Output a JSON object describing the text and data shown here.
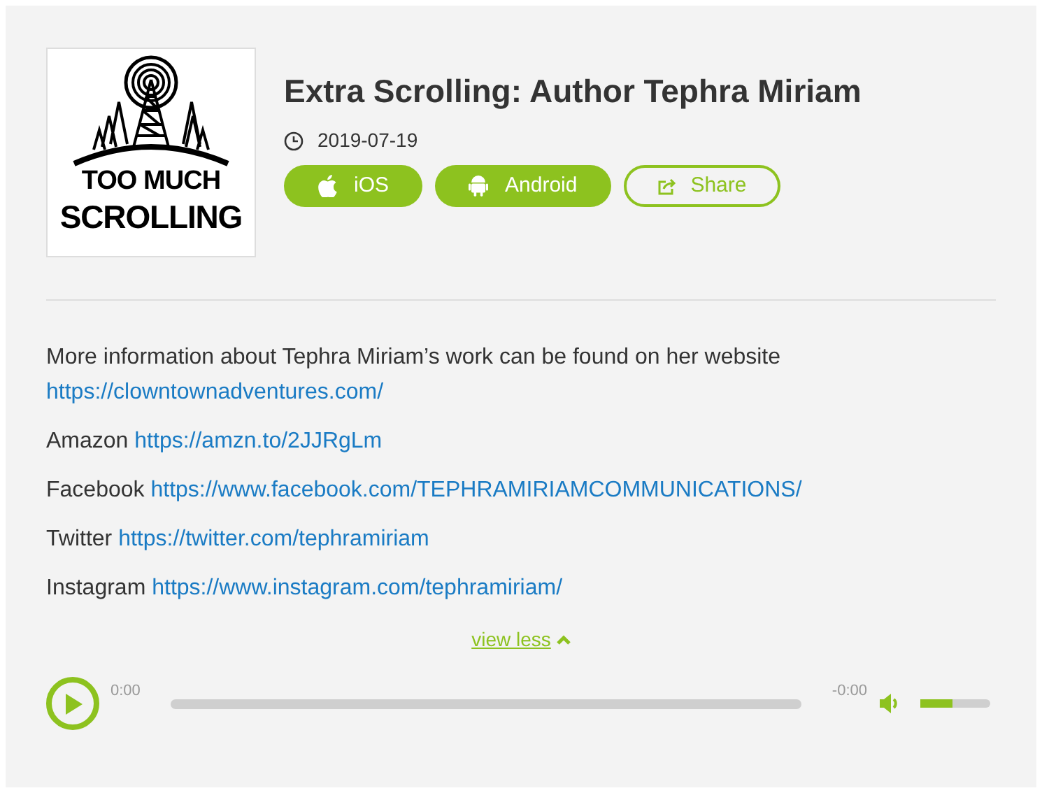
{
  "logo": {
    "line_1": "TOO MUCH",
    "line_2": "SCROLLING"
  },
  "episode": {
    "title": "Extra Scrolling: Author Tephra Miriam",
    "date": "2019-07-19"
  },
  "buttons": [
    {
      "kind": "ios",
      "label": "iOS"
    },
    {
      "kind": "android",
      "label": "Android"
    },
    {
      "kind": "share",
      "label": "Share"
    }
  ],
  "description": [
    {
      "text": "More information about Tephra Miriam’s work can be found on her website",
      "link": "https://clowntownadventures.com/"
    },
    {
      "text": "Amazon",
      "link": "https://amzn.to/2JJRgLm"
    },
    {
      "text": "Facebook",
      "link": "https://www.facebook.com/TEPHRAMIRIAMCOMMUNICATIONS/"
    },
    {
      "text": "Twitter",
      "link": "https://twitter.com/tephramiriam"
    },
    {
      "text": "Instagram",
      "link": "https://www.instagram.com/tephramiriam/"
    }
  ],
  "toggle": {
    "label": "view less",
    "expanded": true
  },
  "player": {
    "elapsed": "0:00",
    "remaining": "-0:00",
    "volume": {
      "level": 0.45
    }
  }
}
